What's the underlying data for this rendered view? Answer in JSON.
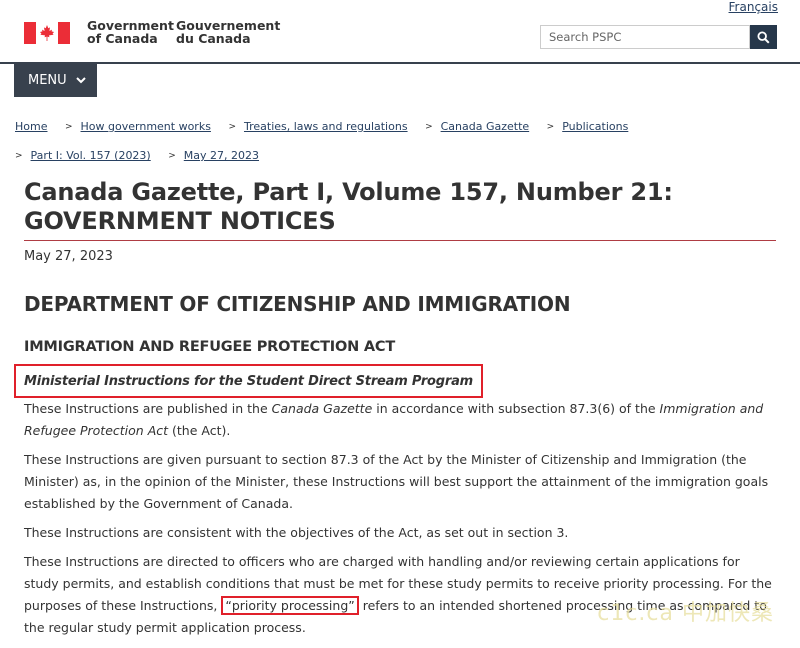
{
  "header": {
    "lang_link": "Français",
    "gov_en_line1": "Government",
    "gov_en_line2": "of Canada",
    "gov_fr_line1": "Gouvernement",
    "gov_fr_line2": "du Canada",
    "search_placeholder": "Search PSPC",
    "menu_label": "MENU",
    "flag_red": "#eb2d37"
  },
  "breadcrumb": [
    {
      "label": "Home"
    },
    {
      "label": "How government works"
    },
    {
      "label": "Treaties, laws and regulations"
    },
    {
      "label": "Canada Gazette"
    },
    {
      "label": "Publications"
    },
    {
      "label": "Part I: Vol. 157 (2023)"
    },
    {
      "label": "May 27, 2023"
    }
  ],
  "main": {
    "title": "Canada Gazette, Part I, Volume 157, Number 21: GOVERNMENT NOTICES",
    "date": "May 27, 2023",
    "department": "DEPARTMENT OF CITIZENSHIP AND IMMIGRATION",
    "act": "IMMIGRATION AND REFUGEE PROTECTION ACT",
    "instructions_title": "Ministerial Instructions for the Student Direct Stream Program",
    "p1_a": "These Instructions are published in the ",
    "p1_b": "Canada Gazette",
    "p1_c": " in accordance with subsection 87.3(6) of the ",
    "p1_d": "Immigration and Refugee Protection Act",
    "p1_e": " (the Act).",
    "p2": "These Instructions are given pursuant to section 87.3 of the Act by the Minister of Citizenship and Immigration (the Minister) as, in the opinion of the Minister, these Instructions will best support the attainment of the immigration goals established by the Government of Canada.",
    "p3": "These Instructions are consistent with the objectives of the Act, as set out in section 3.",
    "p4_a": "These Instructions are directed to officers who are charged with handling and/or reviewing certain applications for study permits, and establish conditions that must be met for these study permits to receive priority processing. For the purposes of these Instructions, ",
    "p4_b": "“priority processing”",
    "p4_c": " refers to an intended shortened processing time as compared to the regular study permit application process."
  },
  "watermark": "c1c.ca 中加快桑",
  "colors": {
    "accent_red": "#af3c43",
    "highlight_red": "#e0202a",
    "menu_bg": "#38414d",
    "search_btn_bg": "#26374a",
    "link": "#284162"
  }
}
